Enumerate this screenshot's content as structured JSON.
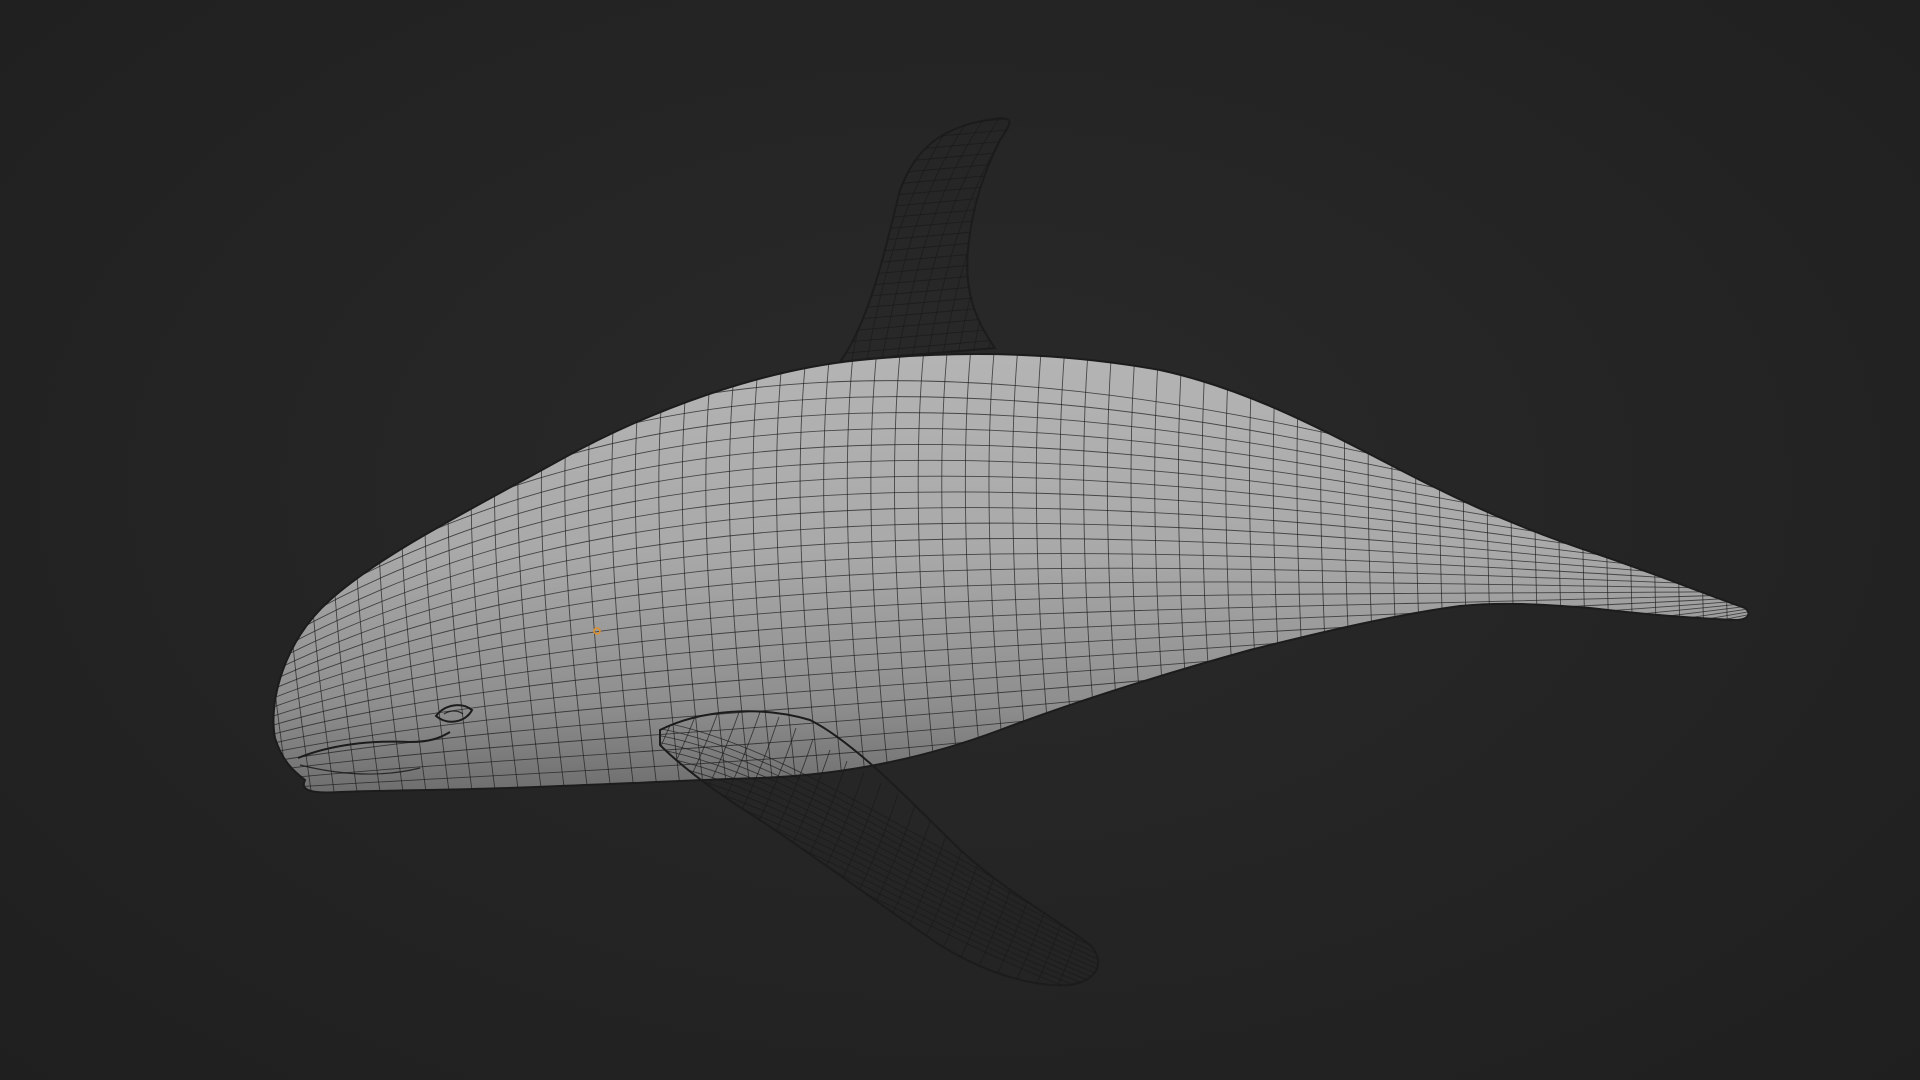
{
  "viewport": {
    "background_color": "#232323",
    "shading": "solid",
    "overlay": "wireframe",
    "object": {
      "kind": "orca-mesh",
      "surface_color": "#a6a6a6",
      "wire_color": "#1a1a1a",
      "origin_color": "#e0902a"
    }
  }
}
